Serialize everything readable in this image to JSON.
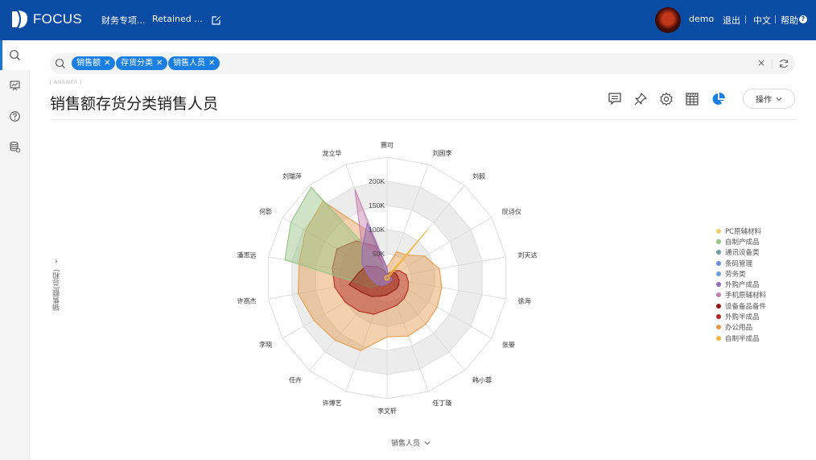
{
  "app": {
    "logo_text": "FOCUS",
    "nav": [
      {
        "label": "财务专项..."
      },
      {
        "label": "Retained ..."
      }
    ],
    "user": {
      "name": "demo"
    },
    "links": {
      "logout": "退出",
      "language": "中文",
      "help": "帮助",
      "help_icon": "?"
    }
  },
  "sidebar": {
    "items": [
      {
        "icon": "search-icon",
        "active": true
      },
      {
        "icon": "presentation-chart-icon",
        "active": false
      },
      {
        "icon": "help-circle-icon",
        "active": false
      },
      {
        "icon": "database-icon",
        "active": false
      }
    ]
  },
  "search": {
    "chips": [
      {
        "label": "销售额"
      },
      {
        "label": "存货分类"
      },
      {
        "label": "销售人员"
      }
    ],
    "clear_label": "×"
  },
  "answer": {
    "tag": "[ ANSWER ]",
    "title": "销售额存货分类销售人员",
    "operate_label": "操作"
  },
  "toolbar": {
    "icons": [
      "comment-icon",
      "pin-icon",
      "settings-icon",
      "table-icon",
      "pie-chart-icon"
    ],
    "active_color": "#1a7fe0"
  },
  "chart_data": {
    "type": "radar",
    "title": "",
    "xlabel": "销售人员",
    "ylabel": "销售额(总和)",
    "rlim": [
      0,
      250000
    ],
    "r_ticks": [
      50000,
      100000,
      150000,
      200000
    ],
    "r_tick_labels": [
      "50K",
      "100K",
      "150K",
      "200K"
    ],
    "grid": true,
    "legend_position": "right",
    "categories": [
      "赛可",
      "刘国李",
      "刘毅",
      "阮诗仪",
      "刘天达",
      "徐海",
      "张晏",
      "韩小蓉",
      "任丁璇",
      "李文轩",
      "许博艺",
      "任卉",
      "李晓",
      "许高杰",
      "潘思远",
      "何影",
      "刘瑞萍",
      "龙立华"
    ],
    "series": [
      {
        "name": "PC原辅材料",
        "color": "#f2d36b",
        "values": [
          0,
          0,
          0,
          0,
          0,
          0,
          0,
          0,
          0,
          0,
          0,
          0,
          0,
          0,
          0,
          0,
          0,
          0
        ]
      },
      {
        "name": "自制产成品",
        "color": "#95c383",
        "values": [
          8000,
          5000,
          5000,
          5000,
          5000,
          5000,
          5000,
          5000,
          5000,
          5000,
          10000,
          15000,
          40000,
          60000,
          215000,
          230000,
          245000,
          30000
        ]
      },
      {
        "name": "通讯设备类",
        "color": "#6f9fa5",
        "values": [
          0,
          0,
          0,
          0,
          0,
          0,
          0,
          0,
          0,
          0,
          0,
          0,
          0,
          0,
          0,
          0,
          0,
          0
        ]
      },
      {
        "name": "条码管理",
        "color": "#6b8fd6",
        "values": [
          0,
          0,
          0,
          0,
          0,
          0,
          0,
          0,
          0,
          0,
          0,
          0,
          0,
          0,
          0,
          0,
          0,
          0
        ]
      },
      {
        "name": "劳务类",
        "color": "#6a9fd8",
        "values": [
          0,
          0,
          0,
          0,
          0,
          0,
          0,
          0,
          0,
          0,
          0,
          0,
          0,
          0,
          0,
          0,
          0,
          0
        ]
      },
      {
        "name": "外购产成品",
        "color": "#8a6fb8",
        "values": [
          20000,
          5000,
          5000,
          5000,
          5000,
          10000,
          10000,
          10000,
          10000,
          12000,
          15000,
          20000,
          25000,
          30000,
          40000,
          60000,
          80000,
          120000
        ]
      },
      {
        "name": "手机原辅材料",
        "color": "#c77fb0",
        "values": [
          20000,
          5000,
          5000,
          5000,
          5000,
          10000,
          10000,
          10000,
          10000,
          12000,
          15000,
          20000,
          25000,
          30000,
          40000,
          60000,
          80000,
          195000
        ]
      },
      {
        "name": "设备备品备件",
        "color": "#8b1a12",
        "values": [
          5000,
          10000,
          15000,
          20000,
          22000,
          25000,
          28000,
          30000,
          30000,
          35000,
          40000,
          50000,
          60000,
          80000,
          60000,
          50000,
          30000,
          15000
        ]
      },
      {
        "name": "外购半成品",
        "color": "#b3261e",
        "values": [
          5000,
          10000,
          20000,
          30000,
          40000,
          45000,
          50000,
          55000,
          60000,
          65000,
          80000,
          90000,
          100000,
          110000,
          115000,
          120000,
          100000,
          70000
        ]
      },
      {
        "name": "办公用品",
        "color": "#e49a4b",
        "values": [
          22000,
          58000,
          62000,
          90000,
          110000,
          115000,
          120000,
          125000,
          128000,
          122000,
          160000,
          168000,
          175000,
          187000,
          185000,
          195000,
          207000,
          100000
        ]
      },
      {
        "name": "自制半成品",
        "color": "#f0b840",
        "values": [
          5000,
          5000,
          130000,
          5000,
          5000,
          5000,
          5000,
          5000,
          5000,
          5000,
          5000,
          5000,
          5000,
          5000,
          5000,
          5000,
          5000,
          5000
        ]
      }
    ]
  }
}
